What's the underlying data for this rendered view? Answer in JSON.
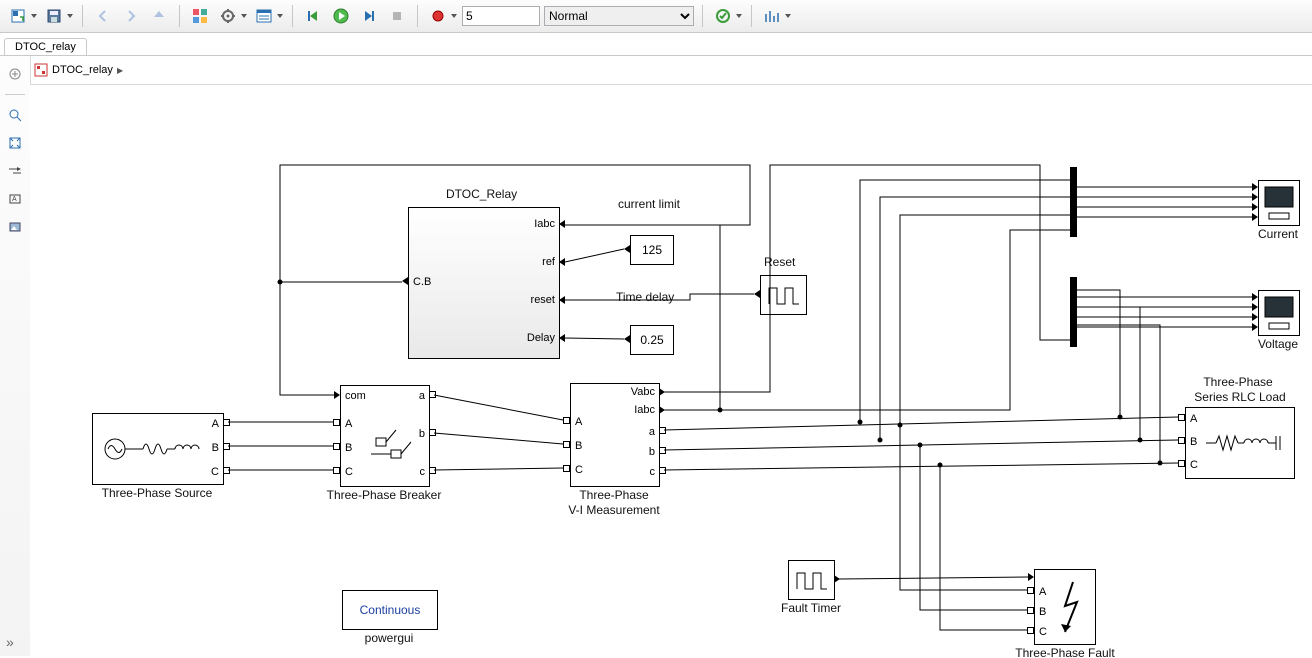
{
  "tab": "DTOC_relay",
  "breadcrumb": "DTOC_relay",
  "stopTime": "5",
  "mode": "Normal",
  "relay": {
    "title": "DTOC_Relay",
    "outLabel": "C.B",
    "ports": {
      "iabc": "Iabc",
      "ref": "ref",
      "reset": "reset",
      "delay": "Delay"
    }
  },
  "currentLimit": {
    "label": "current limit",
    "value": "125"
  },
  "timeDelay": {
    "label": "Time delay",
    "value": "0.25"
  },
  "reset": {
    "label": "Reset"
  },
  "source": {
    "label": "Three-Phase Source",
    "A": "A",
    "B": "B",
    "C": "C"
  },
  "breaker": {
    "label": "Three-Phase Breaker",
    "com": "com",
    "A": "A",
    "B": "B",
    "C": "C",
    "a": "a",
    "b": "b",
    "c": "c"
  },
  "vimeas": {
    "label1": "Three-Phase",
    "label2": "V-I Measurement",
    "Vabc": "Vabc",
    "Iabc": "Iabc",
    "A": "A",
    "B": "B",
    "C": "C",
    "a": "a",
    "b": "b",
    "c": "c"
  },
  "load": {
    "line1": "Three-Phase",
    "line2": "Series RLC Load",
    "A": "A",
    "B": "B",
    "C": "C"
  },
  "scopeCurrent": "Current",
  "scopeVoltage": "Voltage",
  "faultTimer": "Fault Timer",
  "fault": {
    "label": "Three-Phase Fault",
    "A": "A",
    "B": "B",
    "C": "C"
  },
  "powergui": {
    "text": "Continuous",
    "label": "powergui"
  }
}
